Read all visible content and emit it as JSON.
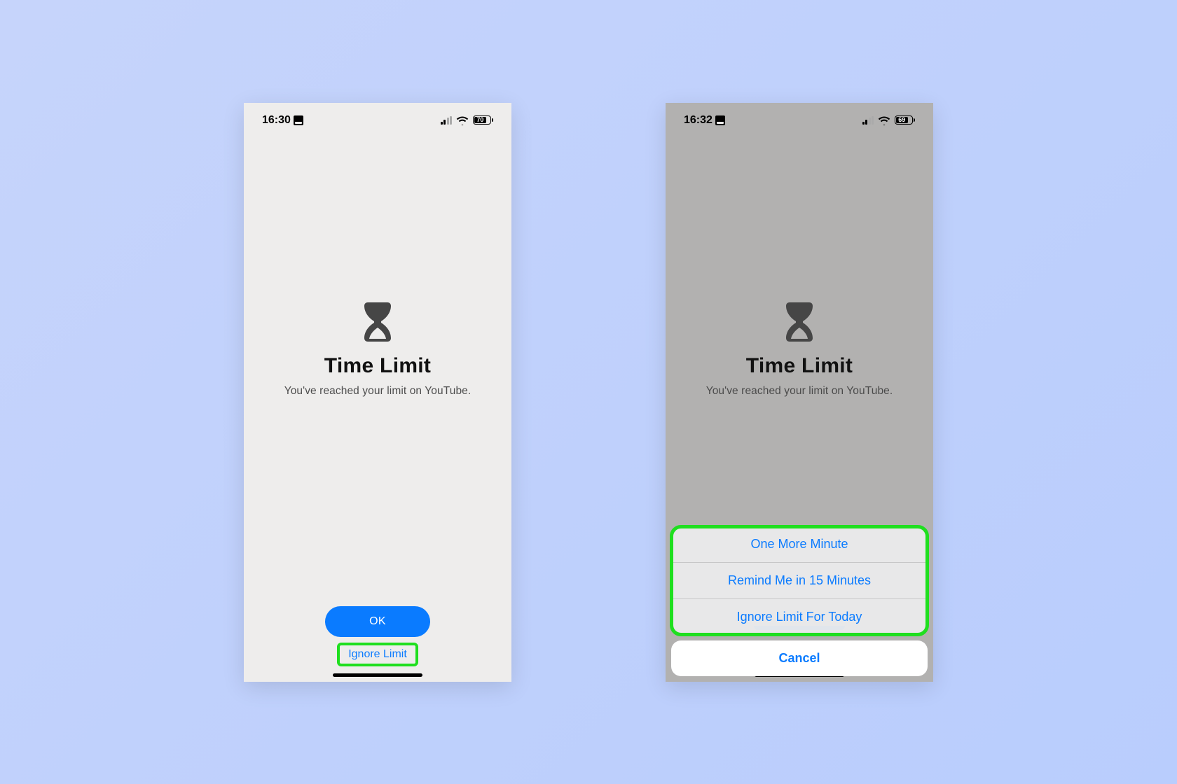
{
  "screens": {
    "left": {
      "status": {
        "time": "16:30",
        "battery": "70",
        "battery_fill_pct": 70
      },
      "main": {
        "title": "Time Limit",
        "subtitle": "You've reached your limit on YouTube."
      },
      "actions": {
        "ok_label": "OK",
        "ignore_label": "Ignore Limit"
      }
    },
    "right": {
      "status": {
        "time": "16:32",
        "battery": "69",
        "battery_fill_pct": 69
      },
      "main": {
        "title": "Time Limit",
        "subtitle": "You've reached your limit on YouTube."
      },
      "sheet": {
        "one_more": "One More Minute",
        "remind_15": "Remind Me in 15 Minutes",
        "ignore_today": "Ignore Limit For Today",
        "cancel": "Cancel"
      }
    }
  },
  "colors": {
    "accent": "#0a7bff",
    "highlight": "#1fdf1f"
  }
}
